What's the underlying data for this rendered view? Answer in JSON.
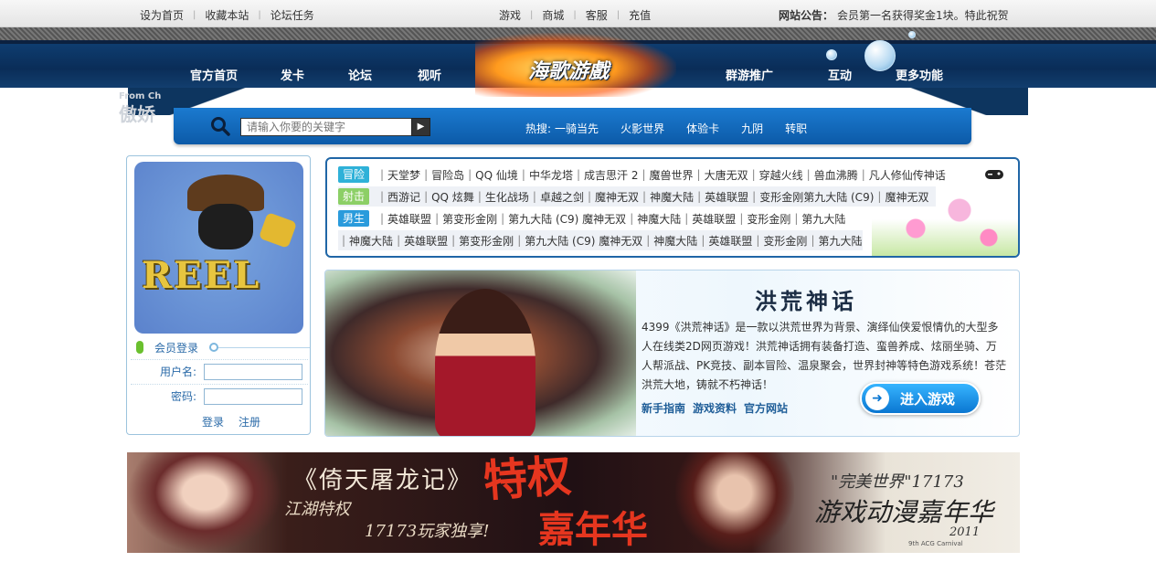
{
  "topbar": {
    "left_links": [
      "设为首页",
      "收藏本站",
      "论坛任务"
    ],
    "mid_links": [
      "游戏",
      "商城",
      "客服",
      "充值"
    ],
    "notice_label": "网站公告：",
    "notice_text": "会员第一名获得奖金1块。特此祝贺"
  },
  "header": {
    "logo_text": "海歌游戲",
    "nav_left": [
      "官方首页",
      "发卡",
      "论坛",
      "视听"
    ],
    "nav_right": [
      "群游推广",
      "互动",
      "更多功能"
    ]
  },
  "watermark": {
    "line1": "From Ch",
    "line2": "傲娇"
  },
  "search": {
    "placeholder": "请输入你要的关键字",
    "go_icon": "play-arrow-icon",
    "hot_label": "热搜:",
    "hot_terms": [
      "一骑当先",
      "火影世界",
      "体验卡",
      "九阴",
      "转职"
    ]
  },
  "login": {
    "avatar_text": "REEL",
    "title": "会员登录",
    "username_label": "用户名:",
    "password_label": "密码:",
    "login_link": "登录",
    "register_link": "注册"
  },
  "categories": {
    "rows": [
      {
        "tag": "冒险",
        "tag_color": "#2fb1d8",
        "items": [
          "天堂梦",
          "冒险岛",
          "QQ 仙境",
          "中华龙塔",
          "成吉思汗 2",
          "魔兽世界",
          "大唐无双",
          "穿越火线",
          "兽血沸腾",
          "凡人修仙传神话"
        ]
      },
      {
        "tag": "射击",
        "tag_color": "#8ccf66",
        "items": [
          "西游记",
          "QQ 炫舞",
          "生化战场",
          "卓越之剑",
          "魔神无双",
          "神魔大陆",
          "英雄联盟",
          "变形金刚第九大陆 (C9)",
          "魔神无双"
        ]
      },
      {
        "tag": "男生",
        "tag_color": "#2a9bdc",
        "items": [
          "英雄联盟",
          "第变形金刚",
          "第九大陆 (C9) 魔神无双",
          "神魔大陆",
          "英雄联盟",
          "变形金刚",
          "第九大陆"
        ]
      },
      {
        "tag": "",
        "tag_color": "",
        "items": [
          "神魔大陆",
          "英雄联盟",
          "第变形金刚",
          "第九大陆 (C9) 魔神无双",
          "神魔大陆",
          "英雄联盟",
          "变形金刚",
          "第九大陆"
        ]
      }
    ]
  },
  "feature": {
    "title": "洪荒神话",
    "description": "4399《洪荒神话》是一款以洪荒世界为背景、演绎仙侠爱恨情仇的大型多人在线类2D网页游戏！洪荒神话拥有装备打造、蛮兽养成、炫丽坐骑、万人帮派战、PK竞技、副本冒险、温泉聚会，世界封神等特色游戏系统！苍茫洪荒大地，铸就不朽神话！",
    "links": [
      "新手指南",
      "游戏资料",
      "官方网站"
    ],
    "enter_button": "进入游戏"
  },
  "banner": {
    "title": "《倚天屠龙记》",
    "line2": "江湖特权",
    "line3": "17173玩家独享!",
    "big1": "特权",
    "big2": "嘉年华",
    "right1": "\"完美世界\"17173",
    "right2": "游戏动漫嘉年华",
    "right3": "2011",
    "right4": "9th ACG Carnival"
  }
}
